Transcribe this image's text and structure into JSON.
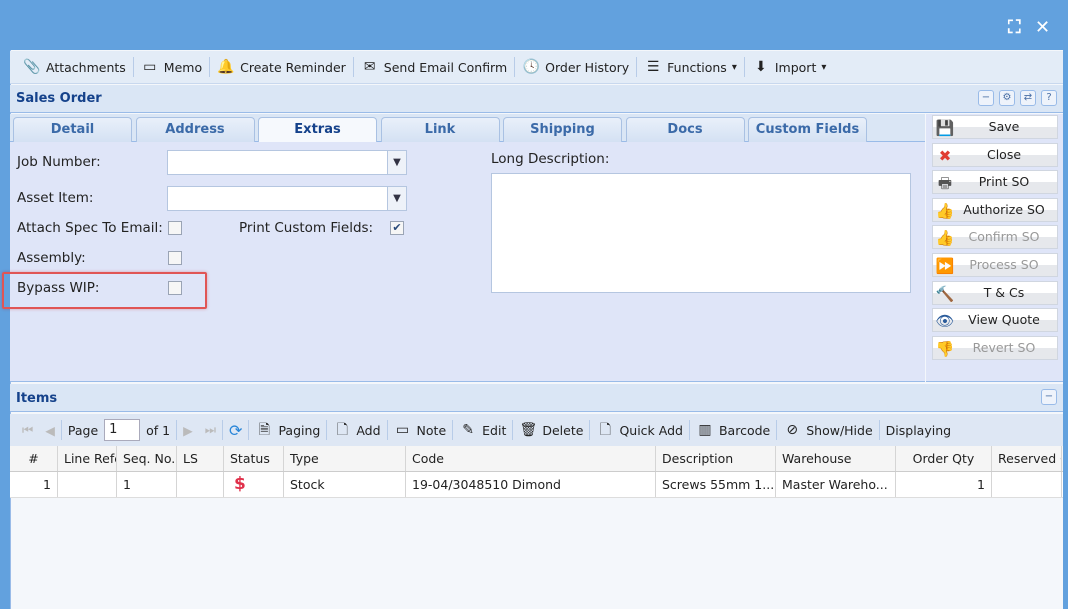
{
  "window": {
    "maximize_icon": "⛶",
    "close_icon": "✕"
  },
  "toolbar": [
    {
      "icon": "paperclip-icon",
      "glyph": "📎",
      "label": "Attachments"
    },
    {
      "icon": "calendar-icon",
      "glyph": "▭",
      "label": "Memo"
    },
    {
      "icon": "bell-icon",
      "glyph": "🔔",
      "label": "Create Reminder"
    },
    {
      "icon": "email-icon",
      "glyph": "✉",
      "label": "Send Email Confirm"
    },
    {
      "icon": "history-icon",
      "glyph": "🕓",
      "label": "Order History"
    },
    {
      "icon": "menu-icon",
      "glyph": "☰",
      "label": "Functions",
      "dropdown": "▾"
    },
    {
      "icon": "download-icon",
      "glyph": "⬇",
      "label": "Import",
      "dropdown": "▾"
    }
  ],
  "header": {
    "title": "Sales Order",
    "tools": [
      "−",
      "⚙",
      "⇄",
      "?"
    ]
  },
  "tabs": [
    "Detail",
    "Address",
    "Extras",
    "Link",
    "Shipping",
    "Docs",
    "Custom Fields"
  ],
  "active_tab": "Extras",
  "form": {
    "job_number_label": "Job Number:",
    "job_number_value": "",
    "asset_item_label": "Asset Item:",
    "asset_item_value": "",
    "attach_spec_label": "Attach Spec To Email:",
    "attach_spec_checked": false,
    "print_custom_label": "Print Custom Fields:",
    "print_custom_checked": true,
    "assembly_label": "Assembly:",
    "assembly_checked": false,
    "bypass_wip_label": "Bypass WIP:",
    "bypass_wip_checked": false,
    "long_description_label": "Long Description:",
    "long_description_value": ""
  },
  "actions": [
    {
      "label": "Save",
      "icon": "save-icon",
      "glyph": "💾",
      "color": "#1e7fd8",
      "enabled": true
    },
    {
      "label": "Close",
      "icon": "close-circle-icon",
      "glyph": "✖",
      "color": "#e03c31",
      "enabled": true
    },
    {
      "label": "Print SO",
      "icon": "printer-icon",
      "glyph": "🖶",
      "color": "#555",
      "enabled": true
    },
    {
      "label": "Authorize SO",
      "icon": "thumbs-up-icon",
      "glyph": "👍",
      "color": "#3aa61e",
      "enabled": true
    },
    {
      "label": "Confirm SO",
      "icon": "thumbs-up-icon",
      "glyph": "👍",
      "color": "#e07070",
      "enabled": false
    },
    {
      "label": "Process SO",
      "icon": "fast-forward-icon",
      "glyph": "⏩",
      "color": "#b07be8",
      "enabled": false
    },
    {
      "label": "T & Cs",
      "icon": "gavel-icon",
      "glyph": "🔨",
      "color": "#8a4b1a",
      "enabled": true
    },
    {
      "label": "View Quote",
      "icon": "eye-icon",
      "glyph": "👁",
      "color": "#2a5b9a",
      "enabled": true
    },
    {
      "label": "Revert SO",
      "icon": "thumbs-down-icon",
      "glyph": "👎",
      "color": "#999",
      "enabled": false
    }
  ],
  "items": {
    "title": "Items",
    "pager": {
      "page_label": "Page",
      "page": "1",
      "of_label": "of 1"
    },
    "toolbar": [
      {
        "icon": "paging-icon",
        "glyph": "🗎",
        "label": "Paging"
      },
      {
        "icon": "add-icon",
        "glyph": "🗋",
        "label": "Add"
      },
      {
        "icon": "note-icon",
        "glyph": "▭",
        "label": "Note"
      },
      {
        "icon": "edit-icon",
        "glyph": "✎",
        "label": "Edit"
      },
      {
        "icon": "delete-icon",
        "glyph": "🗑",
        "label": "Delete"
      },
      {
        "icon": "quick-add-icon",
        "glyph": "🗋",
        "label": "Quick Add"
      },
      {
        "icon": "barcode-icon",
        "glyph": "▥",
        "label": "Barcode"
      },
      {
        "icon": "hide-icon",
        "glyph": "⊘",
        "label": "Show/Hide"
      },
      {
        "icon": "",
        "glyph": "",
        "label": "Displaying"
      }
    ],
    "columns": [
      "#",
      "Line Refe",
      "Seq. No.",
      "LS",
      "Status",
      "Type",
      "Code",
      "Description",
      "Warehouse",
      "Order Qty",
      "Reserved Q"
    ],
    "rows": [
      [
        "1",
        "",
        "1",
        "",
        "$",
        "Stock",
        "19-04/3048510 Dimond",
        "Screws 55mm 1...",
        "Master Wareho...",
        "1",
        ""
      ]
    ]
  }
}
